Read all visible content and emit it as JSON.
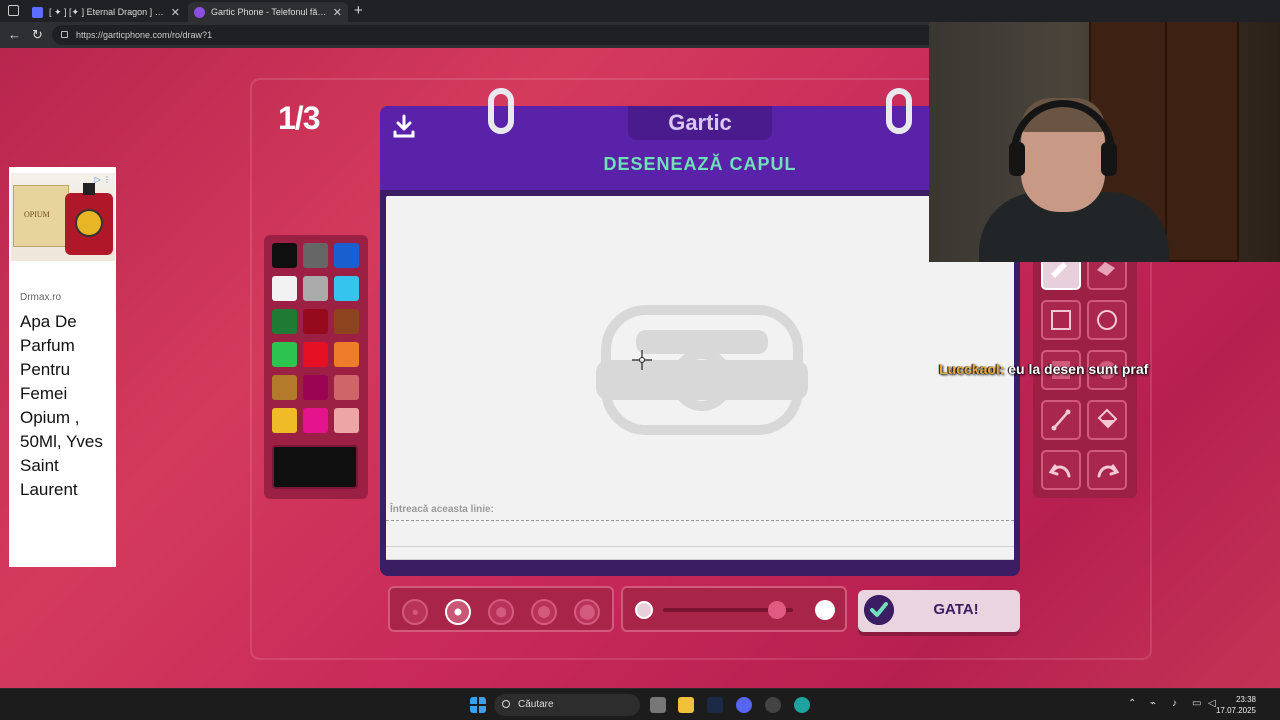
{
  "browser": {
    "tabs": [
      {
        "title": "[ ✦ ] [✦ ] Eternal Dragon ] Horrific",
        "favicon_color": "#5b6cff"
      },
      {
        "title": "Gartic Phone - Telefonul fără fir",
        "favicon_color": "#8a4fe0",
        "active": true
      }
    ],
    "new_tab": "+",
    "url": "https://garticphone.com/ro/draw?1"
  },
  "game": {
    "round_counter": "1/3",
    "brand": "Gartic",
    "task": "DESENEAZĂ CAPUL",
    "trace_hint": "Întreacă aceasta linie:",
    "done_label": "GATA!",
    "palette": [
      "#0f0f10",
      "#666666",
      "#1a5fd0",
      "#f2f2f2",
      "#aaaaaa",
      "#35c4ee",
      "#1f7a33",
      "#950a1c",
      "#8c431e",
      "#2cc44f",
      "#e51023",
      "#ee7c2a",
      "#b47a2c",
      "#9a0452",
      "#cf6469",
      "#efbb27",
      "#e4128c",
      "#eda6a5"
    ],
    "current_color": "#0f0f10",
    "brush_sizes": [
      1,
      2,
      3,
      4,
      5
    ],
    "selected_brush_size": 2,
    "opacity_level": 0.88,
    "tools": [
      "pencil-icon",
      "eraser-icon",
      "rectangle-icon",
      "circle-icon",
      "filled-rectangle-icon",
      "filled-circle-icon",
      "line-icon",
      "fill-bucket-icon",
      "undo-icon",
      "redo-icon"
    ],
    "active_tool": "pencil-icon"
  },
  "ad": {
    "choice": "▷ ⋮",
    "box_text": "OPIUM",
    "domain": "Drmax.ro",
    "title": "Apa De Parfum Pentru Femei Opium , 50Ml, Yves Saint Laurent"
  },
  "chat": {
    "user": "Lucckaol:",
    "message": "eu la desen sunt praf"
  },
  "taskbar": {
    "search_placeholder": "Căutare",
    "time": "23:38",
    "date": "17.07.2025"
  }
}
